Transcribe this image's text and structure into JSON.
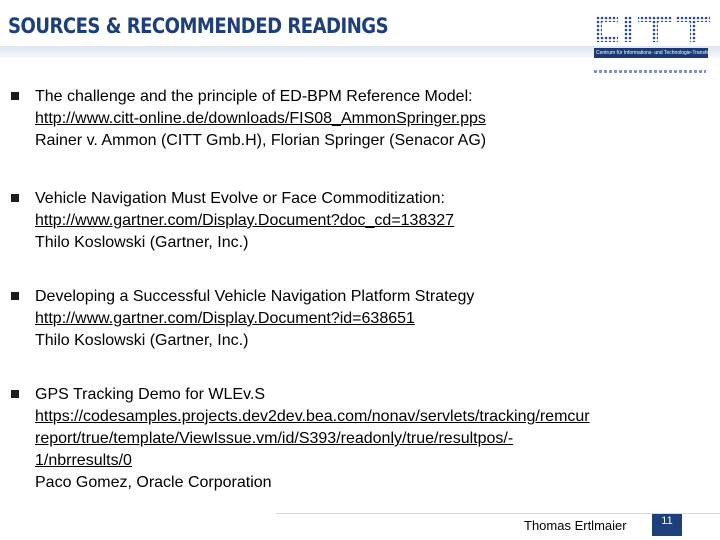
{
  "slide": {
    "title": "SOURCES & RECOMMENDED READINGS",
    "logo": {
      "letters": "CITT",
      "tagline": "Centrum für Informations- und Technologie-Transfer GmbH"
    },
    "items": [
      {
        "lines": [
          {
            "text": "The challenge and the principle of ED-BPM Reference Model:",
            "url": false
          },
          {
            "text": "http://www.citt-online.de/downloads/FIS08_AmmonSpringer.pps",
            "url": true
          },
          {
            "text": "Rainer v. Ammon (CITT Gmb.H), Florian Springer (Senacor AG)",
            "url": false
          }
        ]
      },
      {
        "lines": [
          {
            "text": "Vehicle Navigation Must Evolve or Face Commoditization:",
            "url": false
          },
          {
            "text": "http://www.gartner.com/Display.Document?doc_cd=138327",
            "url": true
          },
          {
            "text": "Thilo Koslowski  (Gartner, Inc.)",
            "url": false
          }
        ]
      },
      {
        "lines": [
          {
            "text": "Developing a Successful Vehicle Navigation Platform Strategy",
            "url": false
          },
          {
            "text": "http://www.gartner.com/Display.Document?id=638651",
            "url": true
          },
          {
            "text": "Thilo Koslowski (Gartner, Inc.)",
            "url": false
          }
        ]
      },
      {
        "lines": [
          {
            "text": "GPS Tracking Demo for WLEv.S",
            "url": false
          },
          {
            "text": "https://codesamples.projects.dev2dev.bea.com/nonav/servlets/tracking/remcur",
            "url": true
          },
          {
            "text": "report/true/template/ViewIssue.vm/id/S393/readonly/true/resultpos/-",
            "url": true
          },
          {
            "text": "1/nbrresults/0",
            "url": true
          },
          {
            "text": "Paco Gomez, Oracle Corporation",
            "url": false
          }
        ]
      }
    ],
    "footer": {
      "presenter": "Thomas Ertlmaier",
      "page_number": "11"
    },
    "colors": {
      "title": "#1d3f7a",
      "accent": "#1d3f7a"
    }
  }
}
